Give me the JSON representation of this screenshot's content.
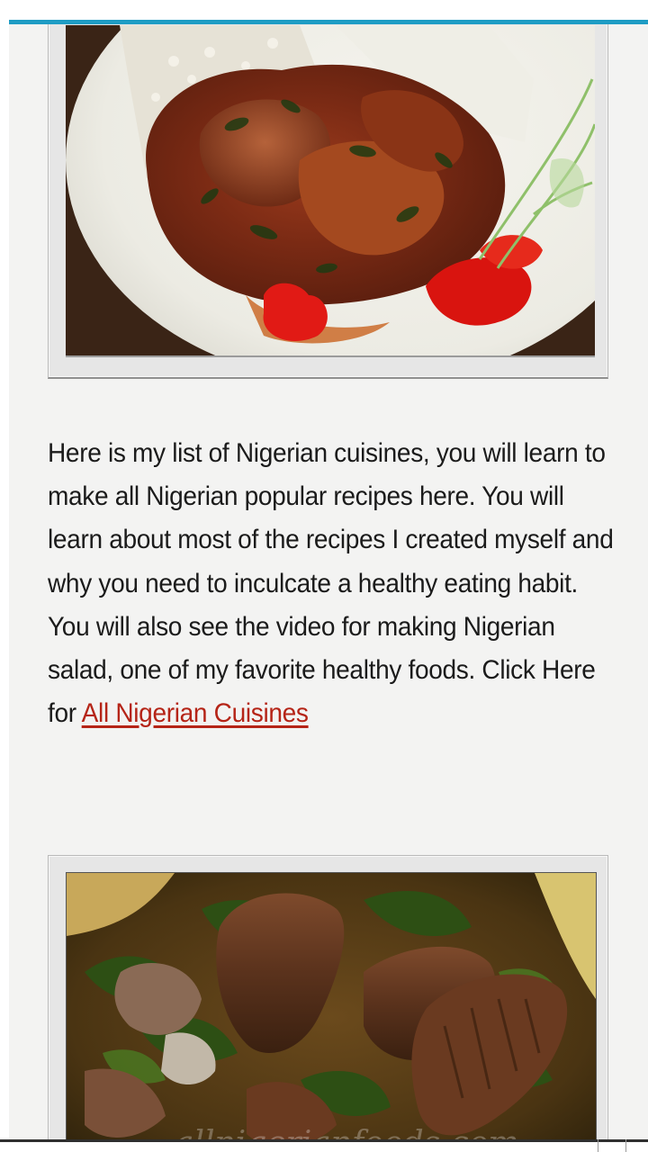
{
  "images": [
    {
      "subject": "stew-with-rice-photo"
    },
    {
      "subject": "vegetable-soup-photo",
      "watermark": "allnigerianfoods.com"
    }
  ],
  "article": {
    "text_before_link": "Here is my list of Nigerian cuisines, you will learn to make all Nigerian popular recipes here. You will learn about most of the recipes I created myself and why you need to inculcate a healthy eating habit. You will also see the video for making Nigerian salad, one of my favorite healthy foods. Click Here for ",
    "link_text": "All Nigerian Cuisines"
  },
  "colors": {
    "accent_bar": "#1e9cc4",
    "link": "#b52417",
    "text": "#1b1b1b",
    "background": "#f3f3f2"
  }
}
